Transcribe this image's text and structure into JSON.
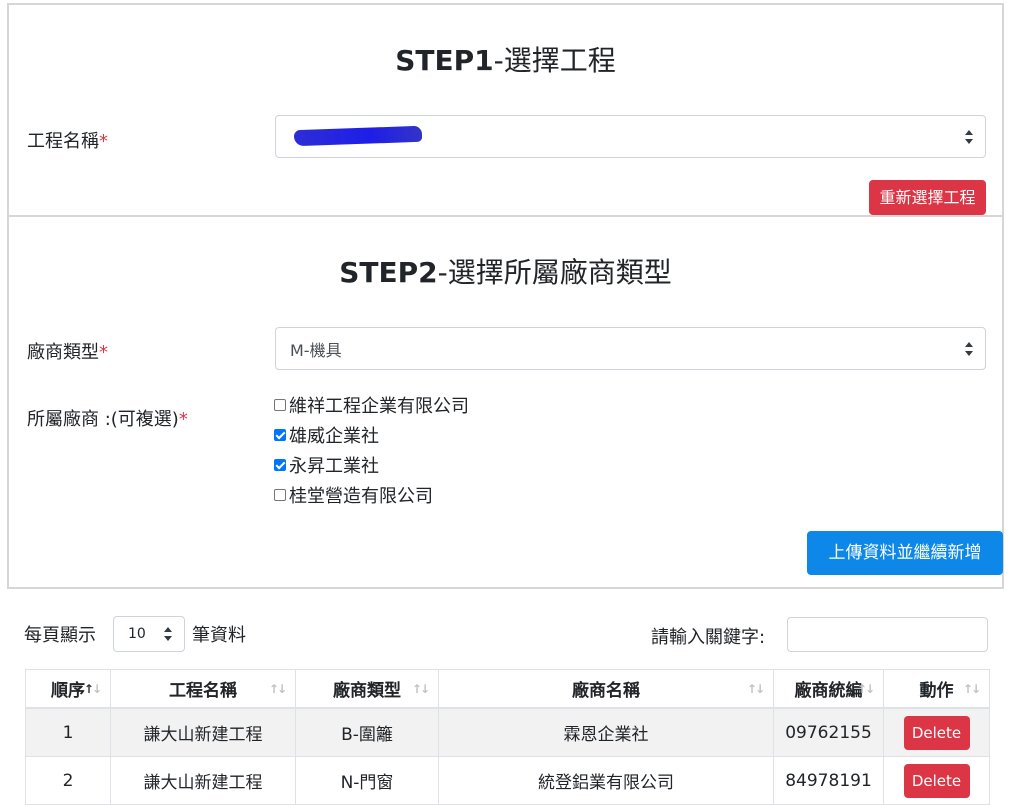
{
  "step1": {
    "title_bold": "STEP1",
    "title_rest": "-選擇工程",
    "project_label": "工程名稱",
    "required_mark": "*",
    "reset_button": "重新選擇工程"
  },
  "step2": {
    "title_bold": "STEP2",
    "title_rest": "-選擇所屬廠商類型",
    "vendor_type_label": "廠商類型",
    "vendor_type_value": "M-機具",
    "vendors_label": "所屬廠商 :(可複選)",
    "vendors": [
      {
        "name": "維祥工程企業有限公司",
        "checked": false
      },
      {
        "name": "雄威企業社",
        "checked": true
      },
      {
        "name": "永昇工業社",
        "checked": true
      },
      {
        "name": "桂堂營造有限公司",
        "checked": false
      }
    ],
    "submit_button": "上傳資料並繼續新增"
  },
  "datatable": {
    "show_prefix": "每頁顯示",
    "page_length": "10",
    "show_suffix": "筆資料",
    "search_label": "請輸入關鍵字:",
    "columns": [
      "順序",
      "工程名稱",
      "廠商類型",
      "廠商名稱",
      "廠商統編",
      "動作"
    ],
    "rows": [
      {
        "index": "1",
        "project": "謙大山新建工程",
        "vendor_type": "B-圍籬",
        "vendor_name": "霖恩企業社",
        "tax_id": "09762155",
        "action": "Delete"
      },
      {
        "index": "2",
        "project": "謙大山新建工程",
        "vendor_type": "N-門窗",
        "vendor_name": "統登鋁業有限公司",
        "tax_id": "84978191",
        "action": "Delete"
      }
    ]
  },
  "colors": {
    "danger": "#dc3545",
    "primary": "#0d87e8",
    "checkbox": "#0075ff"
  }
}
